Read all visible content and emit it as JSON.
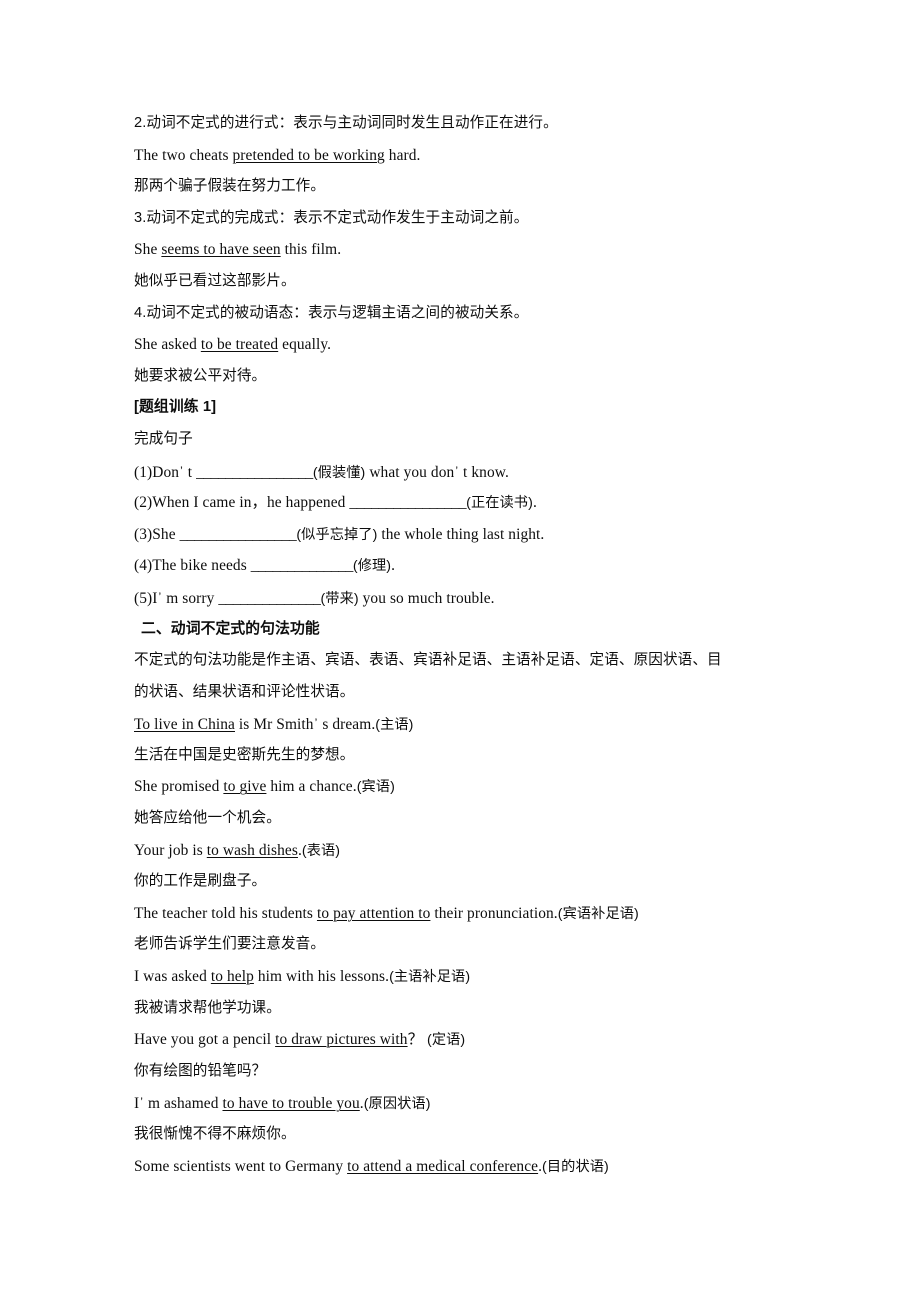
{
  "document": {
    "lines": [
      {
        "id": "point-2-rule",
        "kind": "cn",
        "text": "2.动词不定式的进行式：表示与主动词同时发生且动作正在进行。"
      },
      {
        "id": "point-2-example-en",
        "kind": "en-underline",
        "before": "The two cheats ",
        "underline": "pretended to be working",
        "after": " hard."
      },
      {
        "id": "point-2-example-cn",
        "kind": "cn",
        "text": "那两个骗子假装在努力工作。"
      },
      {
        "id": "point-3-rule",
        "kind": "cn",
        "text": "3.动词不定式的完成式：表示不定式动作发生于主动词之前。"
      },
      {
        "id": "point-3-example-en",
        "kind": "en-underline",
        "before": "She ",
        "underline": "seems to have seen",
        "after": " this film."
      },
      {
        "id": "point-3-example-cn",
        "kind": "cn",
        "text": "她似乎已看过这部影片。"
      },
      {
        "id": "point-4-rule",
        "kind": "cn",
        "text": "4.动词不定式的被动语态：表示与逻辑主语之间的被动关系。"
      },
      {
        "id": "point-4-example-en",
        "kind": "en-underline",
        "before": "She asked ",
        "underline": "to be treated",
        "after": " equally."
      },
      {
        "id": "point-4-example-cn",
        "kind": "cn",
        "text": "她要求被公平对待。"
      }
    ],
    "exercise_block": {
      "title": "[题组训练 1]",
      "instruction": "完成句子",
      "items": [
        {
          "number": "(1)",
          "before": "Don",
          "apostrophe": "’",
          "after_apos": " t ",
          "blank": "________________",
          "hint": "(假装懂)",
          "tail": " what you don",
          "apostrophe2": "’",
          "tail2": " t know."
        },
        {
          "number": "(2)",
          "before": "When I came in，he happened ",
          "blank": "________________",
          "hint": "(正在读书)",
          "tail": "."
        },
        {
          "number": "(3)",
          "before": "She ",
          "blank": "________________",
          "hint": "(似乎忘掉了)",
          "tail": " the whole thing last night."
        },
        {
          "number": "(4)",
          "before": "The bike needs ",
          "blank": "______________",
          "hint": "(修理)",
          "tail": "."
        },
        {
          "number": "(5)",
          "before": "I",
          "apostrophe": "’",
          "after_apos": " m sorry ",
          "blank": "______________",
          "hint": "(带来)",
          "tail": " you so much trouble."
        }
      ]
    },
    "section_two": {
      "heading": "二、动词不定式的句法功能",
      "paragraph_line_1": "不定式的句法功能是作主语、宾语、表语、宾语补足语、主语补足语、定语、原因状语、目",
      "paragraph_line_2": "的状语、结果状语和评论性状语。",
      "examples": [
        {
          "en_before": "",
          "en_underline": "To live in China",
          "en_after": " is Mr Smith",
          "en_apostrophe": "’",
          "en_tail": " s dream.",
          "en_label": "(主语)",
          "cn": "生活在中国是史密斯先生的梦想。"
        },
        {
          "en_before": "She promised ",
          "en_underline": "to give",
          "en_after": " him a chance.",
          "en_label": "(宾语)",
          "cn": "她答应给他一个机会。"
        },
        {
          "en_before": "Your job is ",
          "en_underline": "to wash dishes",
          "en_after": ".",
          "en_label": "(表语)",
          "cn": "你的工作是刷盘子。"
        },
        {
          "en_before": "The teacher told his students ",
          "en_underline": "to pay attention to",
          "en_after": " their pronunciation.",
          "en_label": "(宾语补足语)",
          "cn": "老师告诉学生们要注意发音。"
        },
        {
          "en_before": "I was asked ",
          "en_underline": "to help",
          "en_after": " him with his lessons.",
          "en_label": "(主语补足语)",
          "cn": "我被请求帮他学功课。"
        },
        {
          "en_before": "Have you got a pencil ",
          "en_underline": "to draw pictures with",
          "en_after": "？ ",
          "en_label": "(定语)",
          "cn": "你有绘图的铅笔吗？"
        },
        {
          "en_before": "I",
          "en_apostrophe": "’",
          "en_before2": " m ashamed ",
          "en_underline": "to have to trouble you",
          "en_after": ".",
          "en_label": "(原因状语)",
          "cn": "我很惭愧不得不麻烦你。"
        },
        {
          "en_before": "Some scientists went to Germany ",
          "en_underline": "to attend a medical conference",
          "en_after": ".",
          "en_label": "(目的状语)",
          "cn": ""
        }
      ]
    }
  }
}
